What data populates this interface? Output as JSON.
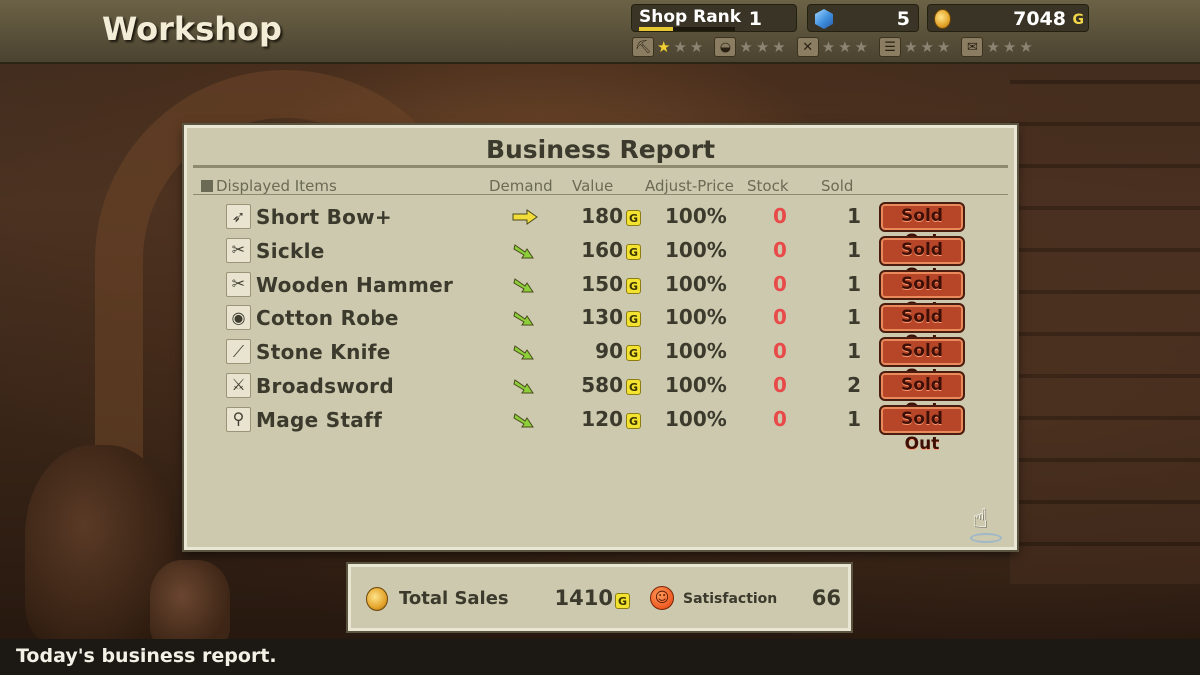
{
  "screen": {
    "title": "Workshop"
  },
  "status": {
    "shop_rank_label": "Shop Rank",
    "shop_rank_progress": 0.35,
    "shop_rank": "1",
    "gems": "5",
    "gold": "7048",
    "gold_unit": "G"
  },
  "categories": [
    {
      "icon": "pickaxe-icon",
      "glyph": "⛏",
      "stars": 1
    },
    {
      "icon": "helmet-icon",
      "glyph": "◒",
      "stars": 0
    },
    {
      "icon": "crossed-tools-icon",
      "glyph": "✕",
      "stars": 0
    },
    {
      "icon": "shelf-icon",
      "glyph": "☰",
      "stars": 0
    },
    {
      "icon": "scroll-icon",
      "glyph": "✉",
      "stars": 0
    }
  ],
  "report": {
    "title": "Business Report",
    "headers": {
      "items": "Displayed Items",
      "demand": "Demand",
      "value": "Value",
      "adjust": "Adjust-Price",
      "stock": "Stock",
      "sold": "Sold"
    },
    "currency_mark": "G",
    "status_label": "Sold Out",
    "rows": [
      {
        "icon": "bow-icon",
        "glyph": "➶",
        "name": "Short Bow+",
        "demand": "flat",
        "value": "180",
        "adjust": "100%",
        "stock": "0",
        "sold": "1"
      },
      {
        "icon": "sickle-icon",
        "glyph": "✂",
        "name": "Sickle",
        "demand": "down",
        "value": "160",
        "adjust": "100%",
        "stock": "0",
        "sold": "1"
      },
      {
        "icon": "hammer-icon",
        "glyph": "✂",
        "name": "Wooden Hammer",
        "demand": "down",
        "value": "150",
        "adjust": "100%",
        "stock": "0",
        "sold": "1"
      },
      {
        "icon": "robe-icon",
        "glyph": "◉",
        "name": "Cotton Robe",
        "demand": "down",
        "value": "130",
        "adjust": "100%",
        "stock": "0",
        "sold": "1"
      },
      {
        "icon": "knife-icon",
        "glyph": "⟋",
        "name": "Stone Knife",
        "demand": "down",
        "value": "90",
        "adjust": "100%",
        "stock": "0",
        "sold": "1"
      },
      {
        "icon": "broadsword-icon",
        "glyph": "⚔",
        "name": "Broadsword",
        "demand": "down",
        "value": "580",
        "adjust": "100%",
        "stock": "0",
        "sold": "2"
      },
      {
        "icon": "staff-icon",
        "glyph": "⚲",
        "name": "Mage Staff",
        "demand": "down",
        "value": "120",
        "adjust": "100%",
        "stock": "0",
        "sold": "1"
      }
    ]
  },
  "summary": {
    "total_sales_label": "Total Sales",
    "total_sales": "1410",
    "currency_mark": "G",
    "satisfaction_label": "Satisfaction",
    "satisfaction": "66"
  },
  "message": "Today's business report.",
  "colors": {
    "panel": "#cdc9ae",
    "sold_out": "#b74527",
    "stock_zero": "#e84a4a",
    "star_on": "#f2cf32",
    "demand_flat": "#f1dc3a",
    "demand_down": "#8ccf3a"
  }
}
